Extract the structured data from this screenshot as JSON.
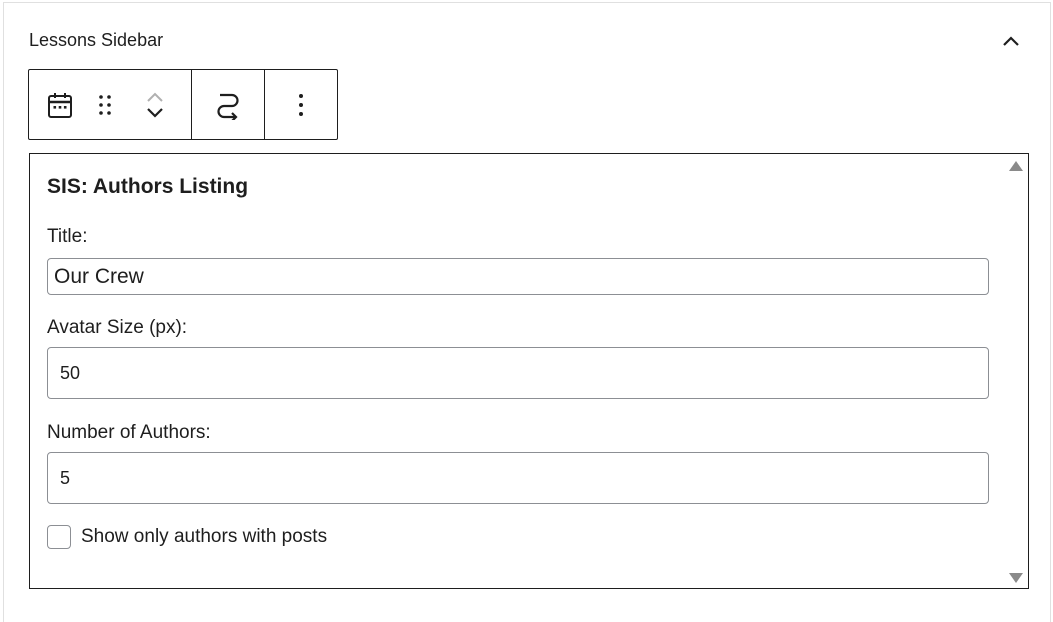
{
  "panel": {
    "title": "Lessons Sidebar"
  },
  "toolbar": {
    "items": [
      "calendar-icon",
      "drag-handle-icon",
      "chevron-up-icon",
      "chevron-down-icon",
      "transform-icon",
      "more-vertical-icon"
    ]
  },
  "widget": {
    "title": "SIS: Authors Listing",
    "fields": {
      "title_label": "Title:",
      "title_value": "Our Crew",
      "avatar_label": "Avatar Size (px):",
      "avatar_value": "50",
      "authors_label": "Number of Authors:",
      "authors_value": "5",
      "checkbox_label": "Show only authors with posts",
      "checkbox_checked": false
    }
  },
  "colors": {
    "text": "#1e1e1e",
    "border": "#1e1e1e",
    "input_border": "#8c8f94",
    "scroll_arrow": "#8a8a8a"
  }
}
